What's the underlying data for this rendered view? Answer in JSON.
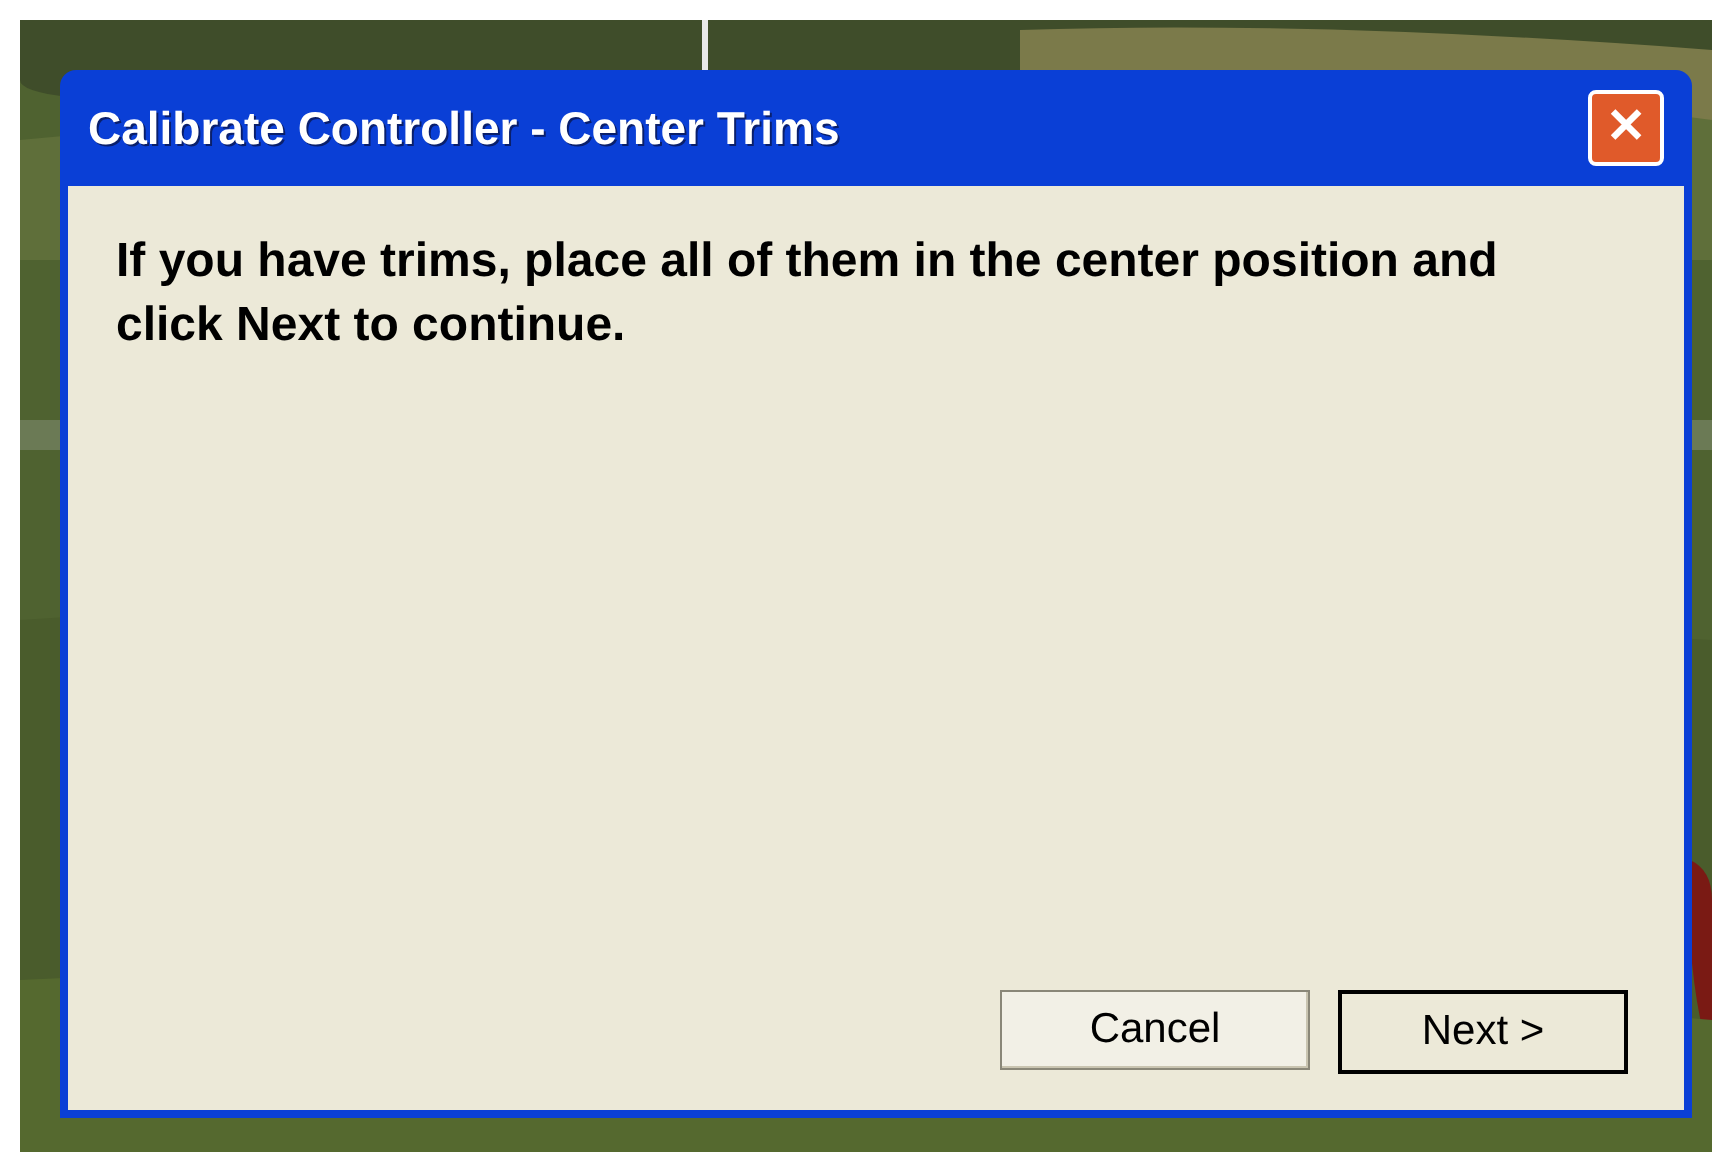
{
  "window": {
    "title": "Calibrate Controller - Center Trims",
    "close": "✕"
  },
  "message": "If you have trims, place all of them in the center position and click Next to continue.",
  "buttons": [
    {
      "label": "Cancel",
      "default": false
    },
    {
      "label": "Next >",
      "default": true
    }
  ]
}
